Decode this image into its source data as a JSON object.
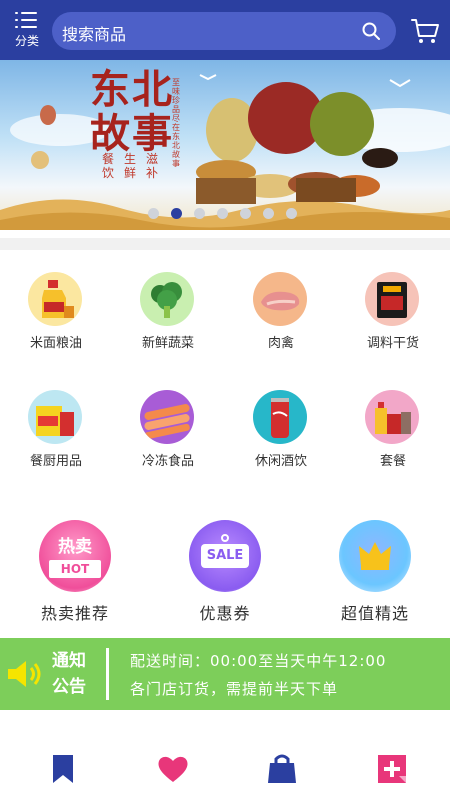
{
  "header": {
    "menu_label": "分类",
    "search_placeholder": "搜索商品"
  },
  "banner": {
    "title_line1": "东北",
    "title_line2": "故事",
    "subtitle": "餐生滋饮鲜补",
    "vertical_text": "至味珍品尽在东北故事",
    "dot_count": 7,
    "active_dot": 1
  },
  "categories": [
    {
      "label": "米面粮油",
      "icon": "oil-bottle-icon"
    },
    {
      "label": "新鲜蔬菜",
      "icon": "broccoli-icon"
    },
    {
      "label": "肉禽",
      "icon": "meat-icon"
    },
    {
      "label": "调料干货",
      "icon": "seasoning-icon"
    },
    {
      "label": "餐厨用品",
      "icon": "kitchen-supplies-icon"
    },
    {
      "label": "冷冻食品",
      "icon": "frozen-food-icon"
    },
    {
      "label": "休闲酒饮",
      "icon": "drink-can-icon"
    },
    {
      "label": "套餐",
      "icon": "combo-icon"
    }
  ],
  "features": [
    {
      "label": "热卖推荐",
      "badge_top": "热卖",
      "badge_bottom": "HOT"
    },
    {
      "label": "优惠券",
      "badge": "SALE"
    },
    {
      "label": "超值精选",
      "icon": "crown-icon"
    }
  ],
  "notice": {
    "title_line1": "通知",
    "title_line2": "公告",
    "line1": "配送时间：00:00至当天中午12:00",
    "line2": "各门店订货，需提前半天下单"
  },
  "bottom_nav": [
    {
      "icon": "bookmark-icon",
      "color": "#2b3fa0"
    },
    {
      "icon": "heart-icon",
      "color": "#e8367a"
    },
    {
      "icon": "shopping-bag-icon",
      "color": "#2b3fa0"
    },
    {
      "icon": "add-note-icon",
      "color": "#e8367a"
    }
  ],
  "colors": {
    "primary": "#2b3fa0",
    "notice_bg": "#7dce5a",
    "accent_pink": "#e8367a"
  }
}
